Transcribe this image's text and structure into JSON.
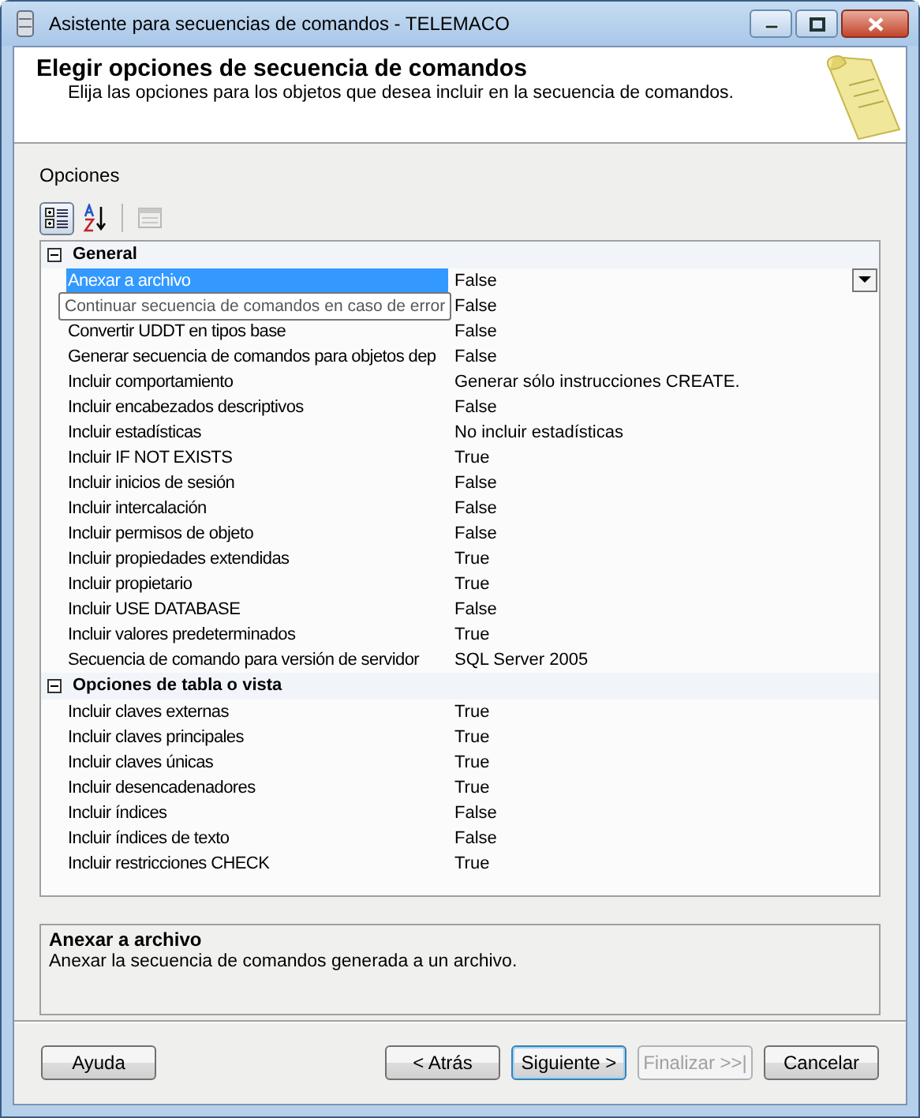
{
  "window": {
    "title": "Asistente para secuencias de comandos - TELEMACO"
  },
  "header": {
    "title": "Elegir opciones de secuencia de comandos",
    "subtitle": "Elija las opciones para los objetos que desea incluir en la secuencia de comandos."
  },
  "options_label": "Opciones",
  "toolbar": [
    {
      "kind": "categorized",
      "selected": true,
      "disabled": false
    },
    {
      "kind": "alphabetical",
      "selected": false,
      "disabled": false
    },
    {
      "kind": "pages",
      "selected": false,
      "disabled": true
    }
  ],
  "grid": {
    "categories": [
      {
        "name": "General",
        "expanded": true,
        "rows": [
          {
            "name": "Anexar a archivo",
            "value": "False",
            "selected": true
          },
          {
            "value": "False",
            "selected": false,
            "tooltip": "Continuar secuencia de comandos en caso de error"
          },
          {
            "name": "Convertir UDDT en tipos base",
            "value": "False",
            "selected": false
          },
          {
            "name": "Generar secuencia de comandos para objetos dep",
            "value": "False",
            "selected": false
          },
          {
            "name": "Incluir comportamiento",
            "value": "Generar sólo instrucciones CREATE.",
            "selected": false
          },
          {
            "name": "Incluir encabezados descriptivos",
            "value": "False",
            "selected": false
          },
          {
            "name": "Incluir estadísticas",
            "value": "No incluir estadísticas",
            "selected": false
          },
          {
            "name": "Incluir IF NOT EXISTS",
            "value": "True",
            "selected": false
          },
          {
            "name": "Incluir inicios de sesión",
            "value": "False",
            "selected": false
          },
          {
            "name": "Incluir intercalación",
            "value": "False",
            "selected": false
          },
          {
            "name": "Incluir permisos de objeto",
            "value": "False",
            "selected": false
          },
          {
            "name": "Incluir propiedades extendidas",
            "value": "True",
            "selected": false
          },
          {
            "name": "Incluir propietario",
            "value": "True",
            "selected": false
          },
          {
            "name": "Incluir USE DATABASE",
            "value": "False",
            "selected": false
          },
          {
            "name": "Incluir valores predeterminados",
            "value": "True",
            "selected": false
          },
          {
            "name": "Secuencia de comando para versión de servidor",
            "value": "SQL Server 2005",
            "selected": false
          }
        ]
      },
      {
        "name": "Opciones de tabla o vista",
        "expanded": true,
        "rows": [
          {
            "name": "Incluir claves externas",
            "value": "True",
            "selected": false
          },
          {
            "name": "Incluir claves principales",
            "value": "True",
            "selected": false
          },
          {
            "name": "Incluir claves únicas",
            "value": "True",
            "selected": false
          },
          {
            "name": "Incluir desencadenadores",
            "value": "True",
            "selected": false
          },
          {
            "name": "Incluir índices",
            "value": "False",
            "selected": false
          },
          {
            "name": "Incluir índices de texto",
            "value": "False",
            "selected": false
          },
          {
            "name": "Incluir restricciones CHECK",
            "value": "True",
            "selected": false
          }
        ]
      }
    ]
  },
  "description": {
    "title": "Anexar a archivo",
    "text": "Anexar la secuencia de comandos generada a un archivo."
  },
  "buttons": [
    {
      "label": "Ayuda",
      "disabled": false,
      "default": false
    },
    {
      "label": "< Atrás",
      "disabled": false,
      "default": false
    },
    {
      "label": "Siguiente >",
      "disabled": false,
      "default": true
    },
    {
      "label": "Finalizar >>|",
      "disabled": true,
      "default": false
    },
    {
      "label": "Cancelar",
      "disabled": false,
      "default": false
    }
  ]
}
